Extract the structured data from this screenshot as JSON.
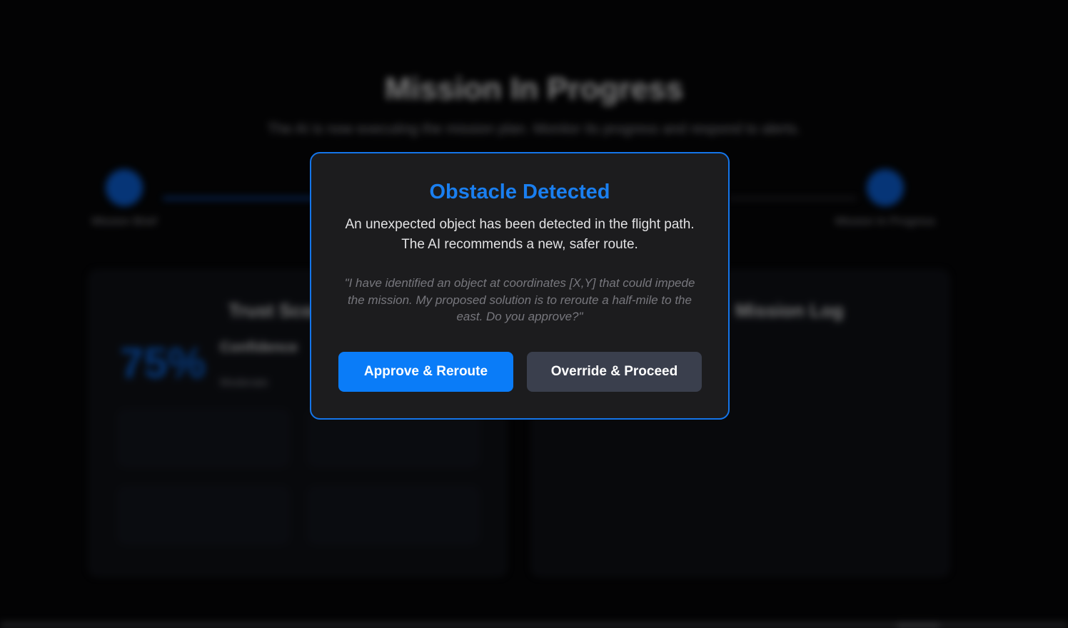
{
  "background": {
    "title": "Mission In Progress",
    "subtitle": "The AI is now executing the mission plan. Monitor its progress and respond to alerts.",
    "steps": [
      {
        "label": "Mission Brief"
      },
      {
        "label": "Mission In Progress"
      }
    ],
    "left_panel": {
      "title": "Trust Score",
      "score": "75%",
      "confidence_label": "Confidence",
      "confidence_note": "Moderate",
      "tiles": [
        {
          "label": "",
          "value": ""
        },
        {
          "label": "",
          "value": ""
        },
        {
          "label": "",
          "value": ""
        },
        {
          "label": "",
          "value": ""
        }
      ]
    },
    "right_panel": {
      "title": "Mission Log"
    }
  },
  "modal": {
    "title": "Obstacle Detected",
    "text": "An unexpected object has been detected in the flight path. The AI recommends a new, safer route.",
    "quote": "\"I have identified an object at coordinates [X,Y] that could impede the mission. My proposed solution is to reroute a half-mile to the east. Do you approve?\"",
    "approve_label": "Approve & Reroute",
    "override_label": "Override & Proceed"
  },
  "colors": {
    "accent": "#1a7ff0",
    "primary_button": "#0a7cf8",
    "secondary_button": "#3a3f4d",
    "modal_background": "#1c1c1e",
    "page_background": "#030304",
    "success": "#1fa24a"
  }
}
